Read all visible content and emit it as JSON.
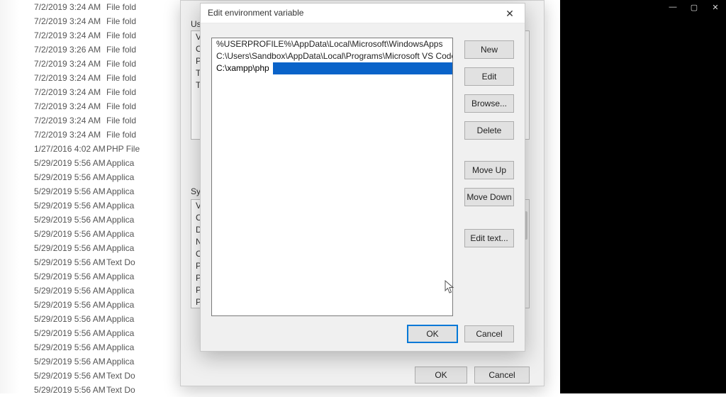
{
  "background_files": [
    {
      "date": "7/2/2019 3:24 AM",
      "type": "File fold"
    },
    {
      "date": "7/2/2019 3:24 AM",
      "type": "File fold"
    },
    {
      "date": "7/2/2019 3:24 AM",
      "type": "File fold"
    },
    {
      "date": "7/2/2019 3:26 AM",
      "type": "File fold"
    },
    {
      "date": "7/2/2019 3:24 AM",
      "type": "File fold"
    },
    {
      "date": "7/2/2019 3:24 AM",
      "type": "File fold"
    },
    {
      "date": "7/2/2019 3:24 AM",
      "type": "File fold"
    },
    {
      "date": "7/2/2019 3:24 AM",
      "type": "File fold"
    },
    {
      "date": "7/2/2019 3:24 AM",
      "type": "File fold"
    },
    {
      "date": "7/2/2019 3:24 AM",
      "type": "File fold"
    },
    {
      "date": "1/27/2016 4:02 AM",
      "type": "PHP File"
    },
    {
      "date": "5/29/2019 5:56 AM",
      "type": "Applica"
    },
    {
      "date": "5/29/2019 5:56 AM",
      "type": "Applica"
    },
    {
      "date": "5/29/2019 5:56 AM",
      "type": "Applica"
    },
    {
      "date": "5/29/2019 5:56 AM",
      "type": "Applica"
    },
    {
      "date": "5/29/2019 5:56 AM",
      "type": "Applica"
    },
    {
      "date": "5/29/2019 5:56 AM",
      "type": "Applica"
    },
    {
      "date": "5/29/2019 5:56 AM",
      "type": "Applica"
    },
    {
      "date": "5/29/2019 5:56 AM",
      "type": "Text Do"
    },
    {
      "date": "5/29/2019 5:56 AM",
      "type": "Applica"
    },
    {
      "date": "5/29/2019 5:56 AM",
      "type": "Applica"
    },
    {
      "date": "5/29/2019 5:56 AM",
      "type": "Applica"
    },
    {
      "date": "5/29/2019 5:56 AM",
      "type": "Applica"
    },
    {
      "date": "5/29/2019 5:56 AM",
      "type": "Applica"
    },
    {
      "date": "5/29/2019 5:56 AM",
      "type": "Applica"
    },
    {
      "date": "5/29/2019 5:56 AM",
      "type": "Applica"
    },
    {
      "date": "5/29/2019 5:56 AM",
      "type": "Text Do"
    },
    {
      "date": "5/29/2019 5:56 AM",
      "type": "Text Do"
    }
  ],
  "env_dialog": {
    "user_label": "User",
    "user_vars": [
      "Va",
      "On",
      "Pat",
      "TE",
      "TM"
    ],
    "sys_label": "Syste",
    "sys_vars": [
      "Va",
      "Co",
      "Dri",
      "NU",
      "OS",
      "Pat",
      "PA",
      "PR",
      "PR"
    ],
    "ok": "OK",
    "cancel": "Cancel"
  },
  "edit_dialog": {
    "title": "Edit environment variable",
    "entries": [
      "%USERPROFILE%\\AppData\\Local\\Microsoft\\WindowsApps",
      "C:\\Users\\Sandbox\\AppData\\Local\\Programs\\Microsoft VS Code\\bin"
    ],
    "editing_value": "C:\\xampp\\php",
    "buttons": {
      "new": "New",
      "edit": "Edit",
      "browse": "Browse...",
      "delete": "Delete",
      "move_up": "Move Up",
      "move_down": "Move Down",
      "edit_text": "Edit text...",
      "ok": "OK",
      "cancel": "Cancel"
    }
  },
  "window_controls": {
    "min": "—",
    "max": "▢",
    "close": "✕"
  }
}
